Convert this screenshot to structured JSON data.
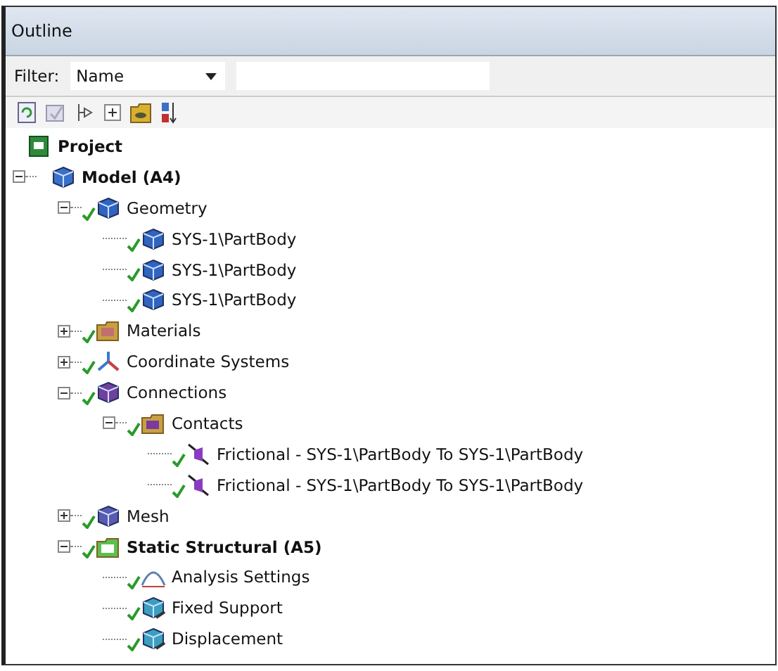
{
  "panel": {
    "title": "Outline"
  },
  "filter": {
    "label": "Filter:",
    "value": "Name"
  },
  "tree": [
    {
      "label": "Project",
      "kind": "project",
      "bold": true,
      "checked": false,
      "children": [
        {
          "label": "Model (A4)",
          "kind": "model",
          "bold": true,
          "checked": false,
          "expanded": true,
          "children": [
            {
              "label": "Geometry",
              "kind": "geometry",
              "checked": true,
              "expanded": true,
              "children": [
                {
                  "label": "SYS-1\\PartBody",
                  "kind": "body",
                  "checked": true
                },
                {
                  "label": "SYS-1\\PartBody",
                  "kind": "body",
                  "checked": true
                },
                {
                  "label": "SYS-1\\PartBody",
                  "kind": "body",
                  "checked": true
                }
              ]
            },
            {
              "label": "Materials",
              "kind": "materials",
              "checked": true,
              "expanded": false
            },
            {
              "label": "Coordinate Systems",
              "kind": "coordinates",
              "checked": true,
              "expanded": false
            },
            {
              "label": "Connections",
              "kind": "connections",
              "checked": true,
              "expanded": true,
              "children": [
                {
                  "label": "Contacts",
                  "kind": "contacts",
                  "checked": true,
                  "expanded": true,
                  "children": [
                    {
                      "label": "Frictional - SYS-1\\PartBody To SYS-1\\PartBody",
                      "kind": "contact",
                      "checked": true
                    },
                    {
                      "label": "Frictional - SYS-1\\PartBody To SYS-1\\PartBody",
                      "kind": "contact",
                      "checked": true
                    }
                  ]
                }
              ]
            },
            {
              "label": "Mesh",
              "kind": "mesh",
              "checked": true,
              "expanded": false
            },
            {
              "label": "Static Structural (A5)",
              "kind": "analysis",
              "bold": true,
              "checked": true,
              "expanded": true,
              "children": [
                {
                  "label": "Analysis Settings",
                  "kind": "settings",
                  "checked": true
                },
                {
                  "label": "Fixed Support",
                  "kind": "support",
                  "checked": true
                },
                {
                  "label": "Displacement",
                  "kind": "displacement",
                  "checked": true
                }
              ]
            }
          ]
        }
      ]
    }
  ]
}
